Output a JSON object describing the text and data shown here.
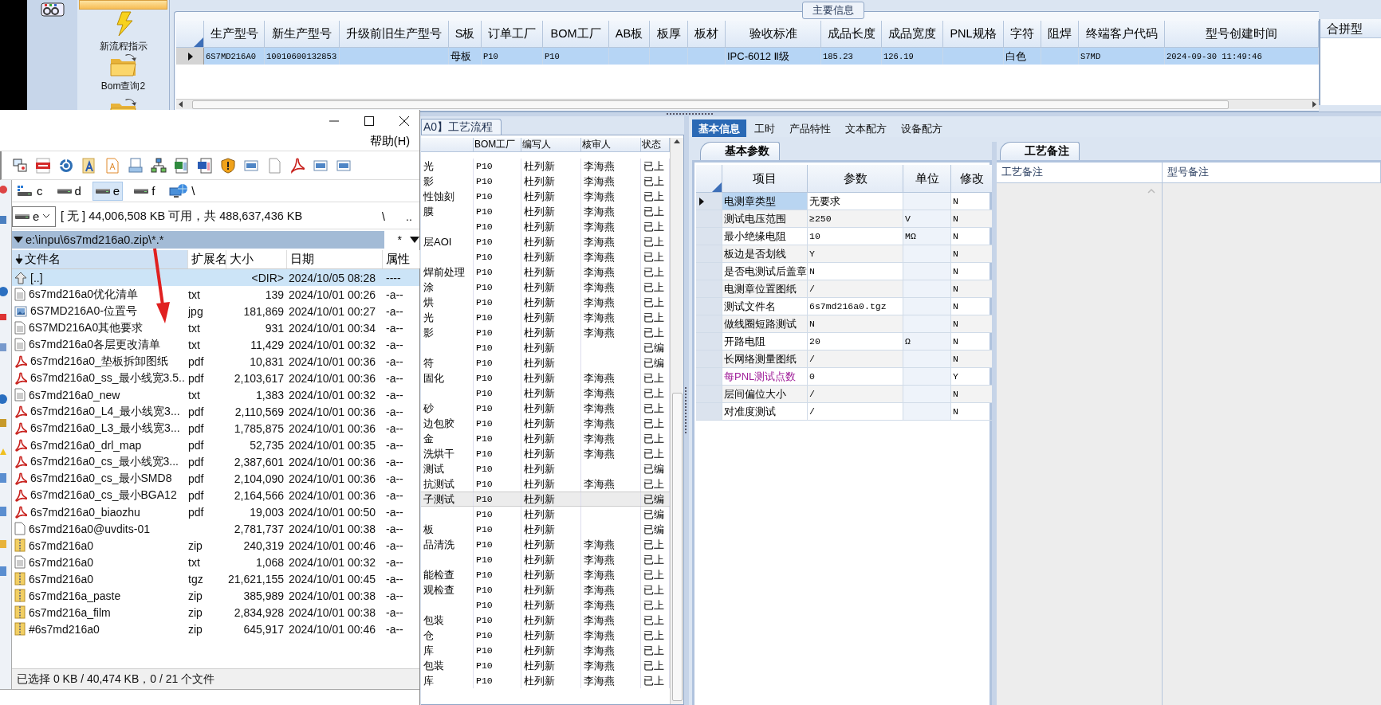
{
  "nav": {
    "items": [
      {
        "kind": "blank",
        "selected": true
      },
      {
        "kind": "lightning",
        "label": "新流程指示",
        "selected": false
      },
      {
        "kind": "folder",
        "label": "Bom查询2",
        "selected": false
      },
      {
        "kind": "folder",
        "selected": false
      }
    ]
  },
  "main_info": {
    "title": "主要信息",
    "columns": [
      "生产型号",
      "新生产型号",
      "升级前旧生产型号",
      "S板",
      "订单工厂",
      "BOM工厂",
      "AB板",
      "板厚",
      "板材",
      "验收标准",
      "成品长度",
      "成品宽度",
      "PNL规格",
      "字符",
      "阻焊",
      "终端客户代码",
      "型号创建时间"
    ],
    "rows": [
      {
        "selected": true,
        "cells": [
          "6S7MD216A0",
          "10010600132853",
          null,
          "母板",
          "P10",
          "P10",
          null,
          null,
          null,
          "IPC-6012 Ⅱ级",
          "185.23",
          "126.19",
          null,
          "白色",
          null,
          "S7MD",
          "2024-09-30 11:49:46"
        ]
      }
    ]
  },
  "merge_panel": {
    "title": "合拼型"
  },
  "process": {
    "tab": "A0】工艺流程",
    "columns": [
      "BOM工厂",
      "编写人",
      "核审人",
      "状态"
    ],
    "rows": [
      {
        "step": "光",
        "factory": "P10",
        "writer": "杜列新",
        "reviewer": "李海燕",
        "status": "已上",
        "selected": false
      },
      {
        "step": "影",
        "factory": "P10",
        "writer": "杜列新",
        "reviewer": "李海燕",
        "status": "已上",
        "selected": false
      },
      {
        "step": "性蚀刻",
        "factory": "P10",
        "writer": "杜列新",
        "reviewer": "李海燕",
        "status": "已上",
        "selected": false
      },
      {
        "step": "膜",
        "factory": "P10",
        "writer": "杜列新",
        "reviewer": "李海燕",
        "status": "已上",
        "selected": false
      },
      {
        "factory": "P10",
        "writer": "杜列新",
        "reviewer": "李海燕",
        "status": "已上",
        "selected": false
      },
      {
        "step": "层AOI",
        "factory": "P10",
        "writer": "杜列新",
        "reviewer": "李海燕",
        "status": "已上",
        "selected": false
      },
      {
        "factory": "P10",
        "writer": "杜列新",
        "reviewer": "李海燕",
        "status": "已上",
        "selected": false
      },
      {
        "step": "焊前处理",
        "factory": "P10",
        "writer": "杜列新",
        "reviewer": "李海燕",
        "status": "已上",
        "selected": false
      },
      {
        "step": "涂",
        "factory": "P10",
        "writer": "杜列新",
        "reviewer": "李海燕",
        "status": "已上",
        "selected": false
      },
      {
        "step": "烘",
        "factory": "P10",
        "writer": "杜列新",
        "reviewer": "李海燕",
        "status": "已上",
        "selected": false
      },
      {
        "step": "光",
        "factory": "P10",
        "writer": "杜列新",
        "reviewer": "李海燕",
        "status": "已上",
        "selected": false
      },
      {
        "step": "影",
        "factory": "P10",
        "writer": "杜列新",
        "reviewer": "李海燕",
        "status": "已上",
        "selected": false
      },
      {
        "factory": "P10",
        "writer": "杜列新",
        "status": "已编",
        "selected": false
      },
      {
        "step": "符",
        "factory": "P10",
        "writer": "杜列新",
        "status": "已编",
        "selected": false
      },
      {
        "step": "固化",
        "factory": "P10",
        "writer": "杜列新",
        "reviewer": "李海燕",
        "status": "已上",
        "selected": false
      },
      {
        "factory": "P10",
        "writer": "杜列新",
        "reviewer": "李海燕",
        "status": "已上",
        "selected": false
      },
      {
        "step": "砂",
        "factory": "P10",
        "writer": "杜列新",
        "reviewer": "李海燕",
        "status": "已上",
        "selected": false
      },
      {
        "step": "边包胶",
        "factory": "P10",
        "writer": "杜列新",
        "reviewer": "李海燕",
        "status": "已上",
        "selected": false
      },
      {
        "step": "金",
        "factory": "P10",
        "writer": "杜列新",
        "reviewer": "李海燕",
        "status": "已上",
        "selected": false
      },
      {
        "step": "洗烘干",
        "factory": "P10",
        "writer": "杜列新",
        "reviewer": "李海燕",
        "status": "已上",
        "selected": false
      },
      {
        "step": "测试",
        "factory": "P10",
        "writer": "杜列新",
        "status": "已编",
        "selected": false
      },
      {
        "step": "抗测试",
        "factory": "P10",
        "writer": "杜列新",
        "reviewer": "李海燕",
        "status": "已上",
        "selected": false
      },
      {
        "step": "子测试",
        "factory": "P10",
        "writer": "杜列新",
        "status": "已编",
        "selected": true
      },
      {
        "factory": "P10",
        "writer": "杜列新",
        "status": "已编",
        "selected": false
      },
      {
        "step": "板",
        "factory": "P10",
        "writer": "杜列新",
        "status": "已编",
        "selected": false
      },
      {
        "step": "品清洗",
        "factory": "P10",
        "writer": "杜列新",
        "reviewer": "李海燕",
        "status": "已上",
        "selected": false
      },
      {
        "factory": "P10",
        "writer": "杜列新",
        "reviewer": "李海燕",
        "status": "已上",
        "selected": false
      },
      {
        "step": "能检查",
        "factory": "P10",
        "writer": "杜列新",
        "reviewer": "李海燕",
        "status": "已上",
        "selected": false
      },
      {
        "step": "观检查",
        "factory": "P10",
        "writer": "杜列新",
        "reviewer": "李海燕",
        "status": "已上",
        "selected": false
      },
      {
        "factory": "P10",
        "writer": "杜列新",
        "reviewer": "李海燕",
        "status": "已上",
        "selected": false
      },
      {
        "step": "包装",
        "factory": "P10",
        "writer": "杜列新",
        "reviewer": "李海燕",
        "status": "已上",
        "selected": false
      },
      {
        "step": "仓",
        "factory": "P10",
        "writer": "杜列新",
        "reviewer": "李海燕",
        "status": "已上",
        "selected": false
      },
      {
        "step": "库",
        "factory": "P10",
        "writer": "杜列新",
        "reviewer": "李海燕",
        "status": "已上",
        "selected": false
      },
      {
        "step": "包装",
        "factory": "P10",
        "writer": "杜列新",
        "reviewer": "李海燕",
        "status": "已上",
        "selected": false
      },
      {
        "step": "库",
        "factory": "P10",
        "writer": "杜列新",
        "reviewer": "李海燕",
        "status": "已上",
        "selected": false
      }
    ]
  },
  "detail": {
    "tabs": [
      {
        "label": "基本信息",
        "selected": true
      },
      {
        "label": "工时",
        "selected": false
      },
      {
        "label": "产品特性",
        "selected": false
      },
      {
        "label": "文本配方",
        "selected": false
      },
      {
        "label": "设备配方",
        "selected": false
      }
    ],
    "params": {
      "tab": "基本参数",
      "columns": [
        "项目",
        "参数",
        "单位",
        "修改"
      ],
      "rows": [
        {
          "item": "电测章类型",
          "value": "无要求",
          "modified": "N",
          "selected": true,
          "highlighted": false
        },
        {
          "item": "测试电压范围",
          "value": "≥250",
          "unit": "V",
          "modified": "N",
          "selected": false,
          "highlighted": false
        },
        {
          "item": "最小绝缘电阻",
          "value": "10",
          "unit": "MΩ",
          "modified": "N",
          "selected": false,
          "highlighted": false
        },
        {
          "item": "板边是否划线",
          "value": "Y",
          "modified": "N",
          "selected": false,
          "highlighted": false
        },
        {
          "item": "是否电测试后盖章",
          "value": "N",
          "modified": "N",
          "selected": false,
          "highlighted": false
        },
        {
          "item": "电测章位置图纸",
          "value": "/",
          "modified": "N",
          "selected": false,
          "highlighted": false
        },
        {
          "item": "测试文件名",
          "value": "6s7md216a0.tgz",
          "modified": "N",
          "selected": false,
          "highlighted": false
        },
        {
          "item": "做线圈短路测试",
          "value": "N",
          "modified": "N",
          "selected": false,
          "highlighted": false
        },
        {
          "item": "开路电阻",
          "value": "20",
          "unit": "Ω",
          "modified": "N",
          "selected": false,
          "highlighted": false
        },
        {
          "item": "长网络测量图纸",
          "value": "/",
          "modified": "N",
          "selected": false,
          "highlighted": false
        },
        {
          "item": "每PNL测试点数",
          "value": "0",
          "modified": "Y",
          "selected": false,
          "highlighted": true
        },
        {
          "item": "层间偏位大小",
          "value": "/",
          "modified": "N",
          "selected": false,
          "highlighted": false
        },
        {
          "item": "对准度测试",
          "value": "/",
          "modified": "N",
          "selected": false,
          "highlighted": false
        }
      ]
    },
    "notes": {
      "tab": "工艺备注",
      "columns": [
        "工艺备注",
        "型号备注"
      ]
    }
  },
  "file_manager": {
    "menu": [
      "帮助(H)"
    ],
    "drives": [
      {
        "label": "c",
        "kind": "system",
        "selected": false
      },
      {
        "label": "d",
        "kind": "disk",
        "selected": false
      },
      {
        "label": "e",
        "kind": "disk",
        "selected": true
      },
      {
        "label": "f",
        "kind": "disk",
        "selected": false
      },
      {
        "label": "\\",
        "kind": "network",
        "selected": false
      }
    ],
    "drive_select": "e",
    "free_space": "[ 无 ] 44,006,508 KB 可用，共 488,637,436 KB",
    "root_button": "\\",
    "up_button": "..",
    "path": "e:\\inpu\\6s7md216a0.zip\\*.*",
    "filter": "*",
    "columns": [
      {
        "label": "文件名",
        "sorted": true
      },
      {
        "label": "扩展名",
        "sorted": false
      },
      {
        "label": "大小",
        "sorted": false
      },
      {
        "label": "日期",
        "sorted": false
      },
      {
        "label": "属性",
        "sorted": false
      }
    ],
    "files": [
      {
        "kind": "up",
        "name": "[..]",
        "size": "<DIR>",
        "date": "2024/10/05 08:28",
        "attr": "----",
        "selected": true
      },
      {
        "kind": "text",
        "name": "6s7md216a0优化清单",
        "ext": "txt",
        "size": "139",
        "date": "2024/10/01 00:26",
        "attr": "-a--",
        "selected": false
      },
      {
        "kind": "image",
        "name": "6S7MD216A0-位置号",
        "ext": "jpg",
        "size": "181,869",
        "date": "2024/10/01 00:27",
        "attr": "-a--",
        "selected": false
      },
      {
        "kind": "text",
        "name": "6S7MD216A0其他要求",
        "ext": "txt",
        "size": "931",
        "date": "2024/10/01 00:34",
        "attr": "-a--",
        "selected": false
      },
      {
        "kind": "text",
        "name": "6s7md216a0各层更改清单",
        "ext": "txt",
        "size": "11,429",
        "date": "2024/10/01 00:32",
        "attr": "-a--",
        "selected": false
      },
      {
        "kind": "pdf",
        "name": "6s7md216a0_垫板拆卸图纸",
        "ext": "pdf",
        "size": "10,831",
        "date": "2024/10/01 00:36",
        "attr": "-a--",
        "selected": false
      },
      {
        "kind": "pdf",
        "name": "6s7md216a0_ss_最小线宽3.5..",
        "ext": "pdf",
        "size": "2,103,617",
        "date": "2024/10/01 00:36",
        "attr": "-a--",
        "selected": false
      },
      {
        "kind": "text",
        "name": "6s7md216a0_new",
        "ext": "txt",
        "size": "1,383",
        "date": "2024/10/01 00:32",
        "attr": "-a--",
        "selected": false
      },
      {
        "kind": "pdf",
        "name": "6s7md216a0_L4_最小线宽3...",
        "ext": "pdf",
        "size": "2,110,569",
        "date": "2024/10/01 00:36",
        "attr": "-a--",
        "selected": false
      },
      {
        "kind": "pdf",
        "name": "6s7md216a0_L3_最小线宽3...",
        "ext": "pdf",
        "size": "1,785,875",
        "date": "2024/10/01 00:36",
        "attr": "-a--",
        "selected": false
      },
      {
        "kind": "pdf",
        "name": "6s7md216a0_drl_map",
        "ext": "pdf",
        "size": "52,735",
        "date": "2024/10/01 00:35",
        "attr": "-a--",
        "selected": false
      },
      {
        "kind": "pdf",
        "name": "6s7md216a0_cs_最小线宽3...",
        "ext": "pdf",
        "size": "2,387,601",
        "date": "2024/10/01 00:36",
        "attr": "-a--",
        "selected": false
      },
      {
        "kind": "pdf",
        "name": "6s7md216a0_cs_最小SMD8",
        "ext": "pdf",
        "size": "2,104,090",
        "date": "2024/10/01 00:36",
        "attr": "-a--",
        "selected": false
      },
      {
        "kind": "pdf",
        "name": "6s7md216a0_cs_最小BGA12",
        "ext": "pdf",
        "size": "2,164,566",
        "date": "2024/10/01 00:36",
        "attr": "-a--",
        "selected": false
      },
      {
        "kind": "pdf",
        "name": "6s7md216a0_biaozhu",
        "ext": "pdf",
        "size": "19,003",
        "date": "2024/10/01 00:50",
        "attr": "-a--",
        "selected": false
      },
      {
        "kind": "blank",
        "name": "6s7md216a0@uvdits-01",
        "size": "2,781,737",
        "date": "2024/10/01 00:38",
        "attr": "-a--",
        "selected": false
      },
      {
        "kind": "zip",
        "name": "6s7md216a0",
        "ext": "zip",
        "size": "240,319",
        "date": "2024/10/01 00:46",
        "attr": "-a--",
        "selected": false
      },
      {
        "kind": "text",
        "name": "6s7md216a0",
        "ext": "txt",
        "size": "1,068",
        "date": "2024/10/01 00:32",
        "attr": "-a--",
        "selected": false
      },
      {
        "kind": "zip",
        "name": "6s7md216a0",
        "ext": "tgz",
        "size": "21,621,155",
        "date": "2024/10/01 00:45",
        "attr": "-a--",
        "selected": false
      },
      {
        "kind": "zip",
        "name": "6s7md216a_paste",
        "ext": "zip",
        "size": "385,989",
        "date": "2024/10/01 00:38",
        "attr": "-a--",
        "selected": false
      },
      {
        "kind": "zip",
        "name": "6s7md216a_film",
        "ext": "zip",
        "size": "2,834,928",
        "date": "2024/10/01 00:38",
        "attr": "-a--",
        "selected": false
      },
      {
        "kind": "zip",
        "name": "#6s7md216a0",
        "ext": "zip",
        "size": "645,917",
        "date": "2024/10/01 00:46",
        "attr": "-a--",
        "selected": false
      }
    ],
    "status": "已选择 0 KB / 40,474 KB，0 / 21 个文件"
  }
}
